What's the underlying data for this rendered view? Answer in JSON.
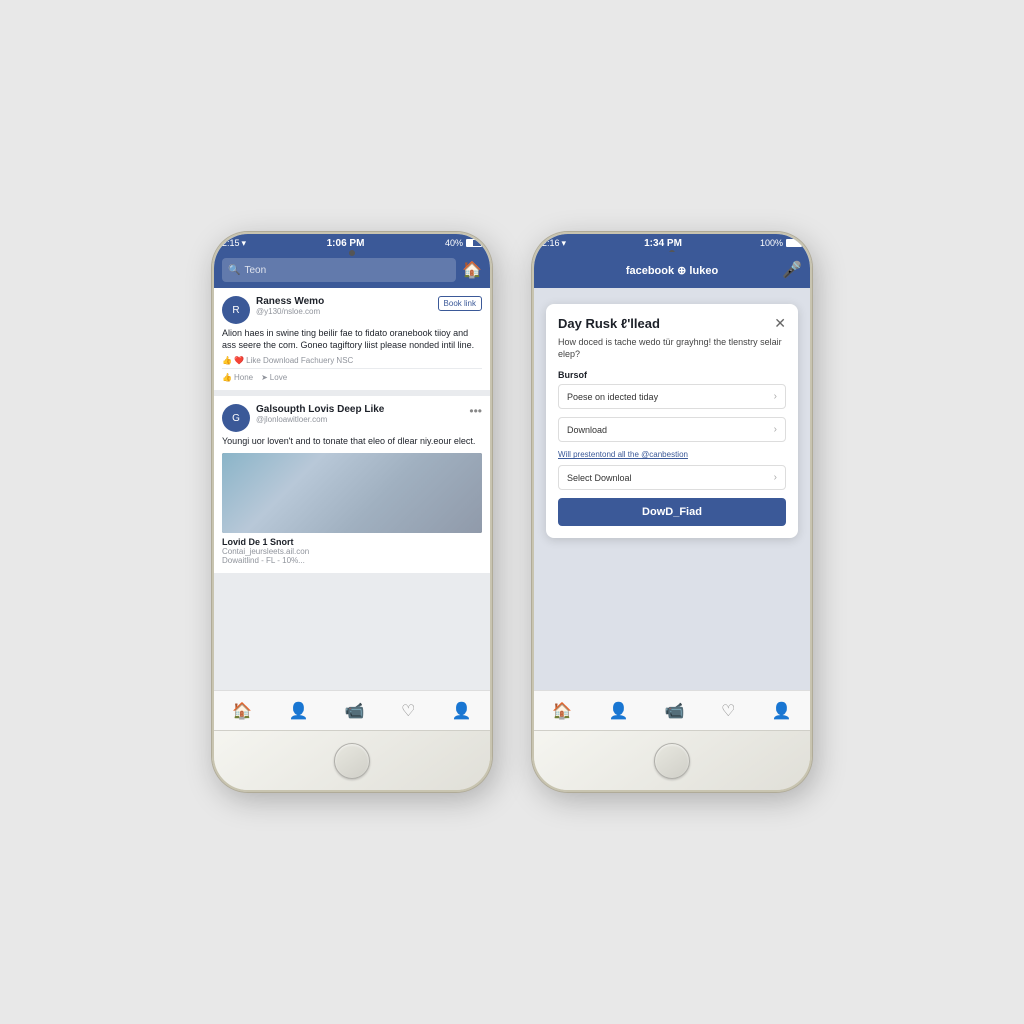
{
  "scene": {
    "background": "#e8e8e8"
  },
  "phone_left": {
    "status": {
      "time": "1:06 PM",
      "signal": "●●●●●",
      "carrier": "2:15",
      "wifi": "WiFi",
      "battery": "40%"
    },
    "nav": {
      "search_placeholder": "Teon",
      "home_icon": "🏠"
    },
    "posts": [
      {
        "name": "Raness Wemo",
        "handle": "@y130/nsloe.com",
        "action_btn": "Book link",
        "text": "Alion haes in swine ting beilir fae to fidato oranebook tiioy and ass seere the com. Goneo tagiftory liist please nonded intil line.",
        "reactions": "Like  Download Fachuery  NSC",
        "actions": [
          "Hone",
          "Love"
        ]
      },
      {
        "name": "Galsoupth Lovis Deep Like",
        "handle": "@jlonloawitloer.com",
        "menu": "...",
        "text": "Youngi uor loven't and to tonate that eleo of dlear niy.eour elect.",
        "video_title": "Lovid De 1 Snort",
        "video_sub": "Contai_jeursleets.ail.con",
        "video_note": "Dowaitlind - FL - 10%..."
      }
    ],
    "tabs": [
      "🏠",
      "👤",
      "🔔",
      "♡",
      "👤"
    ]
  },
  "phone_right": {
    "status": {
      "time": "1:34 PM",
      "carrier": "2:16",
      "battery": "100%"
    },
    "nav": {
      "title": "facebook ⊕ lukeo",
      "mic_icon": "🎤"
    },
    "dialog": {
      "close_icon": "✕",
      "title": "Day Rusk ℓ'llead",
      "question": "How doced is tache wedo tür grayhng! the tlenstry selair elep?",
      "label": "Bursof",
      "options": [
        {
          "label": "Poese on idected tiday",
          "value": "Poese on idected tiday"
        },
        {
          "label": "Download",
          "value": "Download"
        },
        {
          "label": "Select Downloal",
          "value": "Select Downloal"
        }
      ],
      "note": "Will prestentond all the @canbestion",
      "button_label": "DowD_Fiad"
    },
    "tabs": [
      "🏠",
      "👤",
      "🔔",
      "♡",
      "👤"
    ]
  }
}
